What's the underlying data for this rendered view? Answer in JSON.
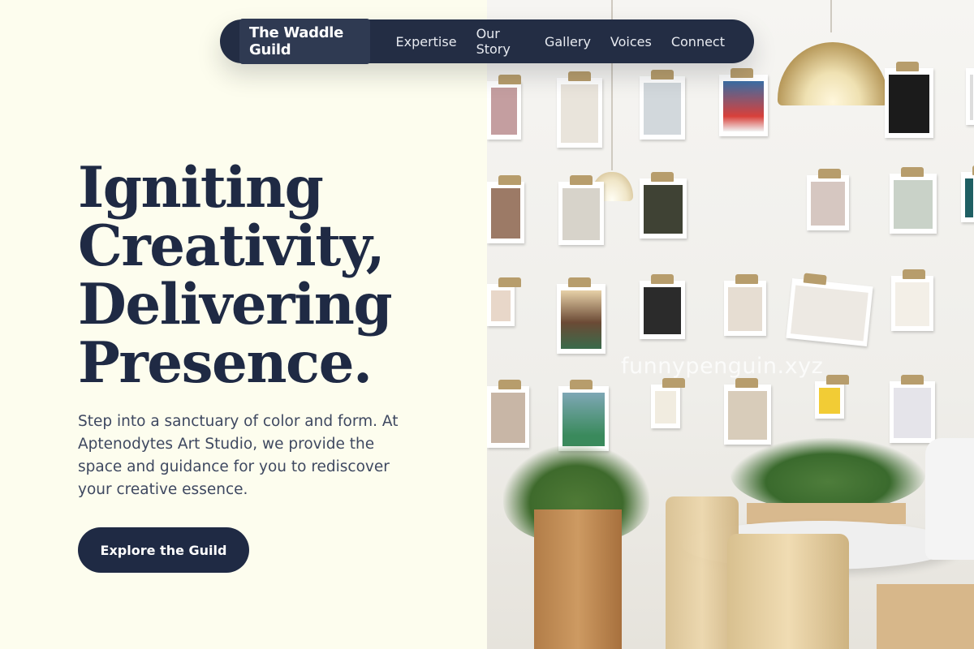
{
  "nav": {
    "brand": "The Waddle Guild",
    "links": [
      "Expertise",
      "Our Story",
      "Gallery",
      "Voices",
      "Connect"
    ]
  },
  "hero": {
    "headline_lines": [
      "Igniting",
      "Creativity,",
      "Delivering",
      "Presence."
    ],
    "subtext": "Step into a sanctuary of color and form. At Aptenodytes Art Studio, we provide the space and guidance for you to rediscover your creative essence.",
    "cta_label": "Explore the Guild"
  },
  "photo": {
    "watermark": "funnypenguin.xyz"
  },
  "colors": {
    "navy": "#1f2a44",
    "cream": "#fdfdee",
    "nav_bg": "#232d44"
  }
}
